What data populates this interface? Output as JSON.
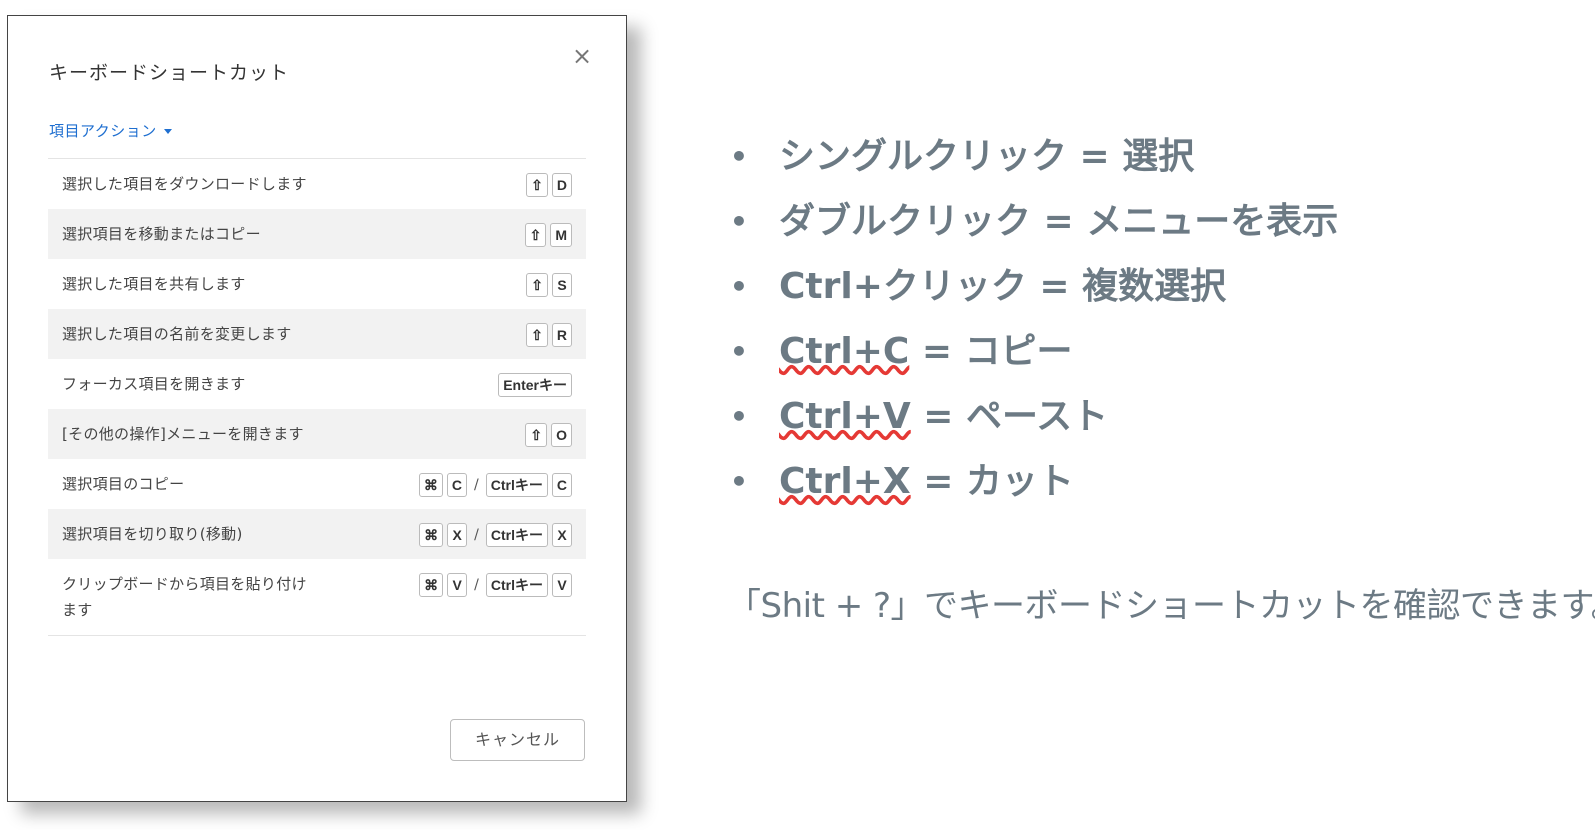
{
  "dialog": {
    "title": "キーボードショートカット",
    "close_label": "×",
    "section_label": "項目アクション",
    "cancel_label": "キャンセル",
    "rows": [
      {
        "desc": "選択した項目をダウンロードします",
        "keys": [
          "⇧",
          "D"
        ]
      },
      {
        "desc": "選択項目を移動またはコピー",
        "keys": [
          "⇧",
          "M"
        ]
      },
      {
        "desc": "選択した項目を共有します",
        "keys": [
          "⇧",
          "S"
        ]
      },
      {
        "desc": "選択した項目の名前を変更します",
        "keys": [
          "⇧",
          "R"
        ]
      },
      {
        "desc": "フォーカス項目を開きます",
        "keys": [
          "Enterキー"
        ]
      },
      {
        "desc": "[その他の操作]メニューを開きます",
        "keys": [
          "⇧",
          "O"
        ]
      },
      {
        "desc": "選択項目のコピー",
        "keys": [
          "⌘",
          "C",
          "/",
          "Ctrlキー",
          "C"
        ]
      },
      {
        "desc": "選択項目を切り取り(移動)",
        "keys": [
          "⌘",
          "X",
          "/",
          "Ctrlキー",
          "X"
        ]
      },
      {
        "desc": "クリップボードから項目を貼り付けます",
        "keys": [
          "⌘",
          "V",
          "/",
          "Ctrlキー",
          "V"
        ]
      }
    ]
  },
  "tips": {
    "bullet": "•",
    "items": [
      {
        "keyword": "シングルクリック",
        "rest": " = 選択",
        "squiggle": false
      },
      {
        "keyword": "ダブルクリック",
        "rest": " = メニューを表示",
        "squiggle": false
      },
      {
        "keyword": "Ctrl+クリック",
        "rest": " = 複数選択",
        "squiggle": false
      },
      {
        "keyword": "Ctrl+C",
        "rest": " = コピー",
        "squiggle": true
      },
      {
        "keyword": "Ctrl+V",
        "rest": " = ペースト",
        "squiggle": true
      },
      {
        "keyword": "Ctrl+X",
        "rest": " = カット",
        "squiggle": true
      }
    ],
    "note": "「Shit + ?」でキーボードショートカットを確認できます。"
  },
  "colors": {
    "link": "#1f6fd0",
    "tip_text": "#6c7a84",
    "squiggle": "#e53935"
  }
}
